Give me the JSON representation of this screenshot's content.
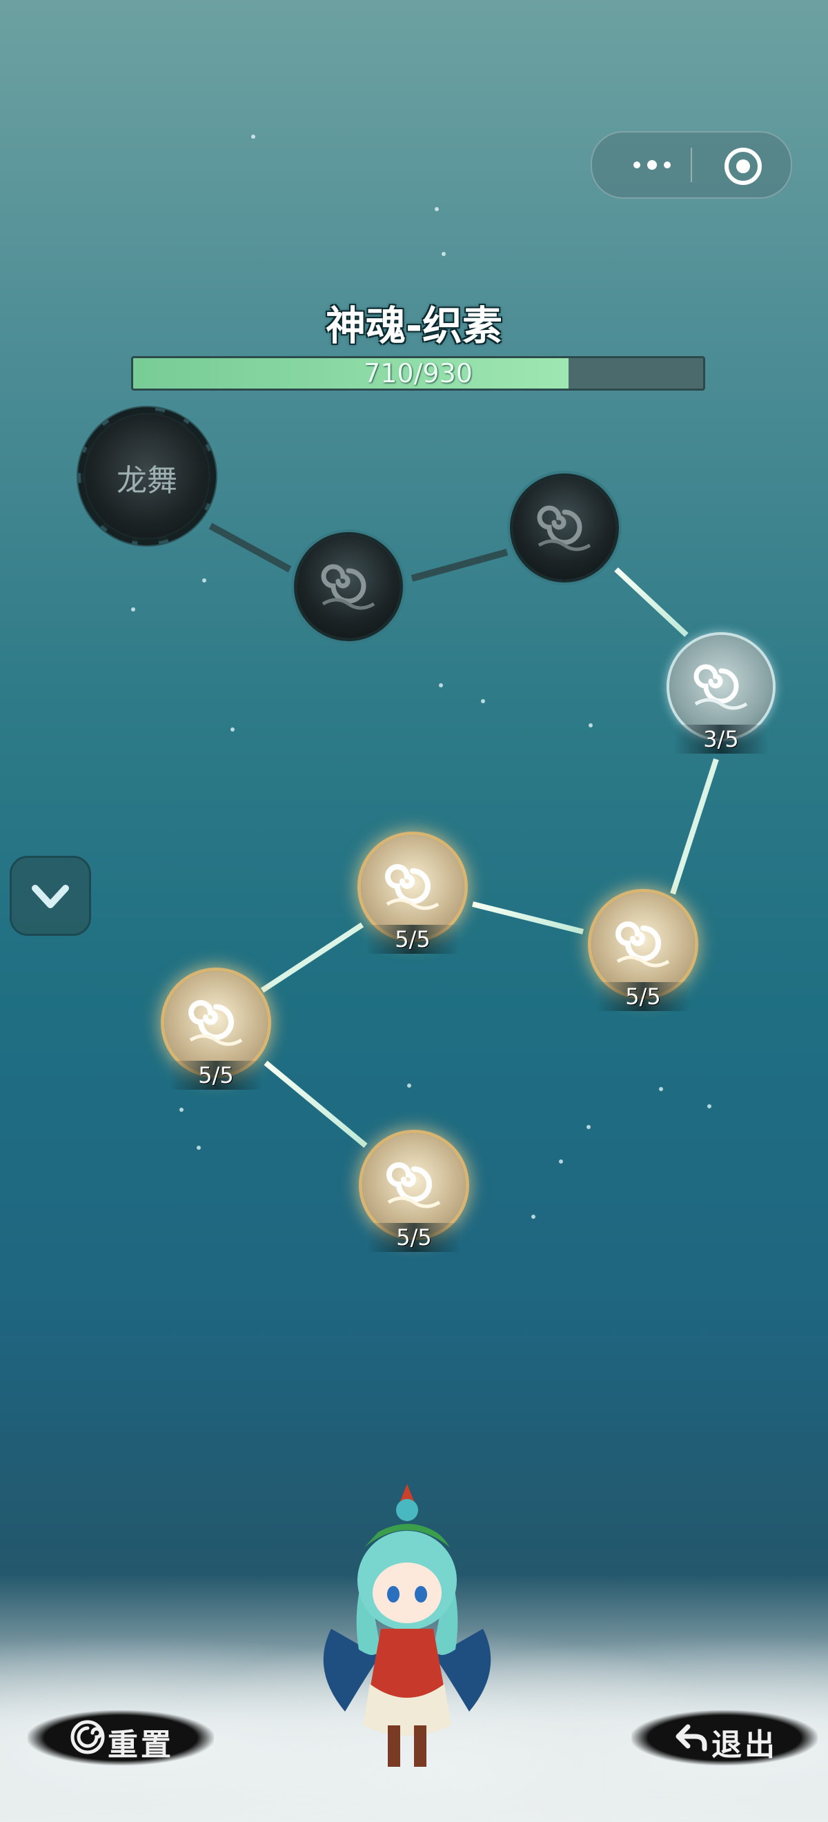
{
  "capsule": {
    "menu_icon": "more-dots-icon",
    "close_icon": "target-icon"
  },
  "header": {
    "title": "神魂-织素",
    "progress_text": "710/930",
    "progress_value": 710,
    "progress_max": 930,
    "fill_color": "#8ee0a8"
  },
  "tree": {
    "root_label": "龙舞",
    "nodes": [
      {
        "state": "locked",
        "level": ""
      },
      {
        "state": "locked",
        "level": ""
      },
      {
        "state": "partial",
        "level": "3/5"
      },
      {
        "state": "done",
        "level": "5/5"
      },
      {
        "state": "done",
        "level": "5/5"
      },
      {
        "state": "done",
        "level": "5/5"
      },
      {
        "state": "done",
        "level": "5/5"
      }
    ]
  },
  "side_button": {
    "icon": "chevron-down-icon"
  },
  "footer": {
    "reset_label": "重置",
    "exit_label": "退出",
    "reset_icon": "swirl-icon",
    "exit_icon": "back-arrow-icon"
  }
}
